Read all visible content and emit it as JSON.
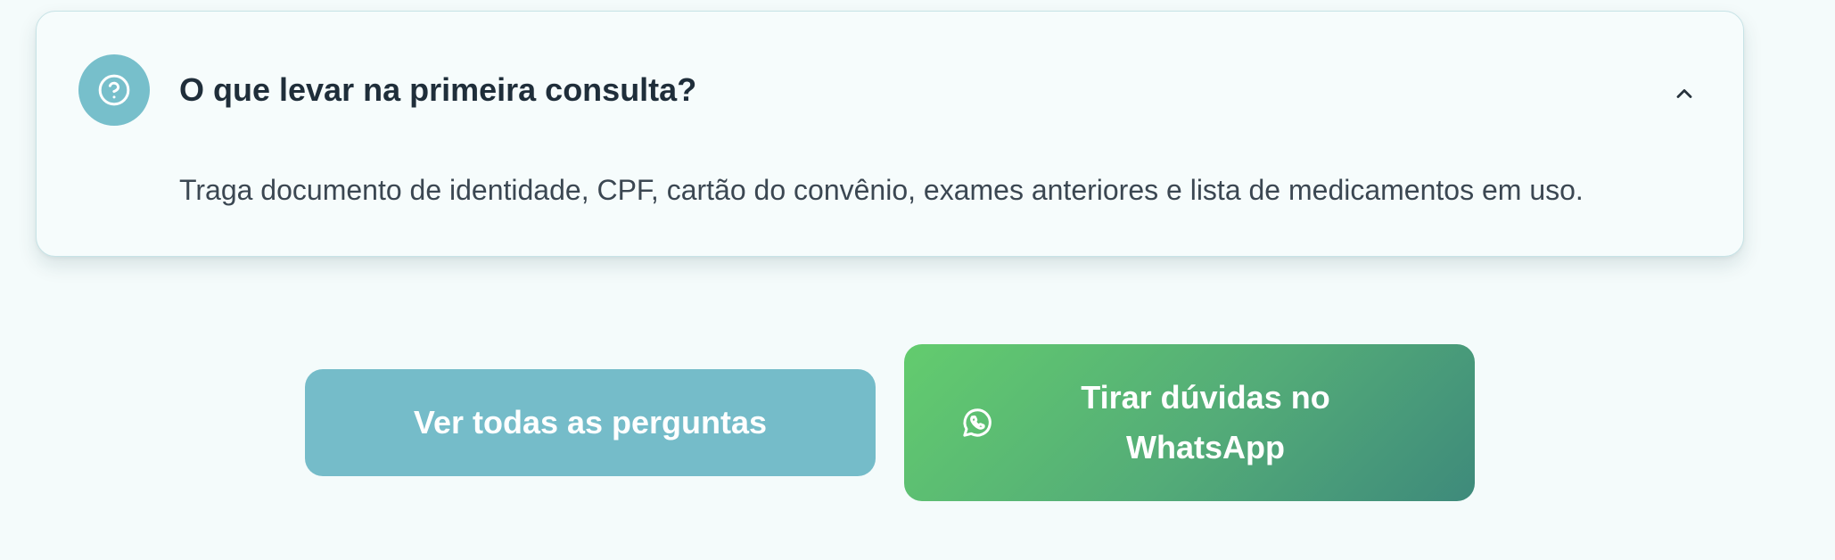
{
  "faq": {
    "question": "O que levar na primeira consulta?",
    "answer": "Traga documento de identidade, CPF, cartão do convênio, exames anteriores e lista de medicamentos em uso.",
    "expanded": true,
    "icon": "question-circle-icon",
    "toggle_icon": "chevron-up-icon"
  },
  "actions": {
    "all_questions_label": "Ver todas as perguntas",
    "whatsapp_label": "Tirar dúvidas no WhatsApp",
    "whatsapp_icon": "whatsapp-icon"
  },
  "colors": {
    "background": "#f4fbfb",
    "accent": "#75bcc9",
    "whatsapp_gradient_start": "#63cc6e",
    "whatsapp_gradient_end": "#3e8a7b",
    "heading_text": "#1f2e3a",
    "body_text": "#3b4752"
  }
}
